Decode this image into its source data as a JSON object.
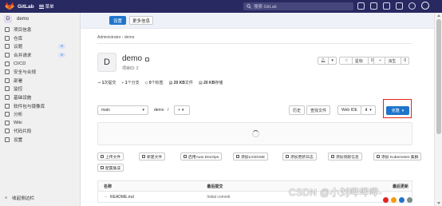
{
  "colors": {
    "topbar": "#292961",
    "accent": "#1f75cb",
    "highlight": "#e4231c",
    "sidebar_bg": "#f0f0f0"
  },
  "topbar": {
    "app_name": "GitLab",
    "menu_label": "菜单",
    "search_placeholder": "搜索 GitLab",
    "icons": [
      "plus-icon",
      "issues-icon",
      "merge-requests-icon",
      "todos-icon",
      "help-icon",
      "avatar"
    ]
  },
  "sidebar": {
    "project_initial": "D",
    "project_name": "demo",
    "items": [
      {
        "label": "项目信息",
        "icon": "info-icon"
      },
      {
        "label": "仓库",
        "icon": "repository-icon"
      },
      {
        "label": "议题",
        "icon": "issues-icon",
        "badge": "0"
      },
      {
        "label": "合并请求",
        "icon": "merge-request-icon",
        "badge": "0"
      },
      {
        "label": "CI/CD",
        "icon": "rocket-icon"
      },
      {
        "label": "安全与合规",
        "icon": "shield-icon"
      },
      {
        "label": "部署",
        "icon": "deploy-icon"
      },
      {
        "label": "监控",
        "icon": "monitor-icon"
      },
      {
        "label": "基础设施",
        "icon": "infrastructure-icon"
      },
      {
        "label": "软件包与镜像库",
        "icon": "package-icon"
      },
      {
        "label": "分析",
        "icon": "chart-icon"
      },
      {
        "label": "Wiki",
        "icon": "book-icon"
      },
      {
        "label": "代码片段",
        "icon": "snippet-icon"
      },
      {
        "label": "设置",
        "icon": "settings-icon"
      }
    ],
    "collapse_label": "收起侧边栏"
  },
  "alert": {
    "primary_label": "设置",
    "secondary_label": "更多信息"
  },
  "breadcrumb": {
    "parent": "Administrator",
    "current": "demo"
  },
  "project": {
    "initial": "D",
    "name": "demo",
    "id_text": "项目ID: 2",
    "star_label": "星标",
    "star_count": "0",
    "fork_label": "派生",
    "fork_count": "0"
  },
  "stats": [
    {
      "value": "1",
      "label": "次提交"
    },
    {
      "value": "1",
      "label": "个分支"
    },
    {
      "value": "0",
      "label": "个标签"
    },
    {
      "value": "20 KB",
      "label": "文件"
    },
    {
      "value": "20 KB",
      "label": "存储"
    }
  ],
  "toolbar": {
    "branch": "main",
    "path": "demo",
    "path_sep": "/",
    "add_label": "+",
    "history_label": "历史",
    "find_file_label": "查找文件",
    "web_ide_label": "Web IDE",
    "download_label": "⬇",
    "clone_label": "克隆"
  },
  "quick_actions": [
    "上传文件",
    "新建文件",
    "启用Auto DevOps",
    "添加LICENSE",
    "添加更新日志",
    "添加贡献信息",
    "添加 Kubernetes 集群",
    "配置集成"
  ],
  "file_table": {
    "headers": [
      "名称",
      "最后提交",
      "最后更新"
    ],
    "rows": [
      {
        "name": "README.md",
        "commit": "Initial commit"
      }
    ]
  },
  "watermark": "CSDN @小刘哔哔哔-"
}
